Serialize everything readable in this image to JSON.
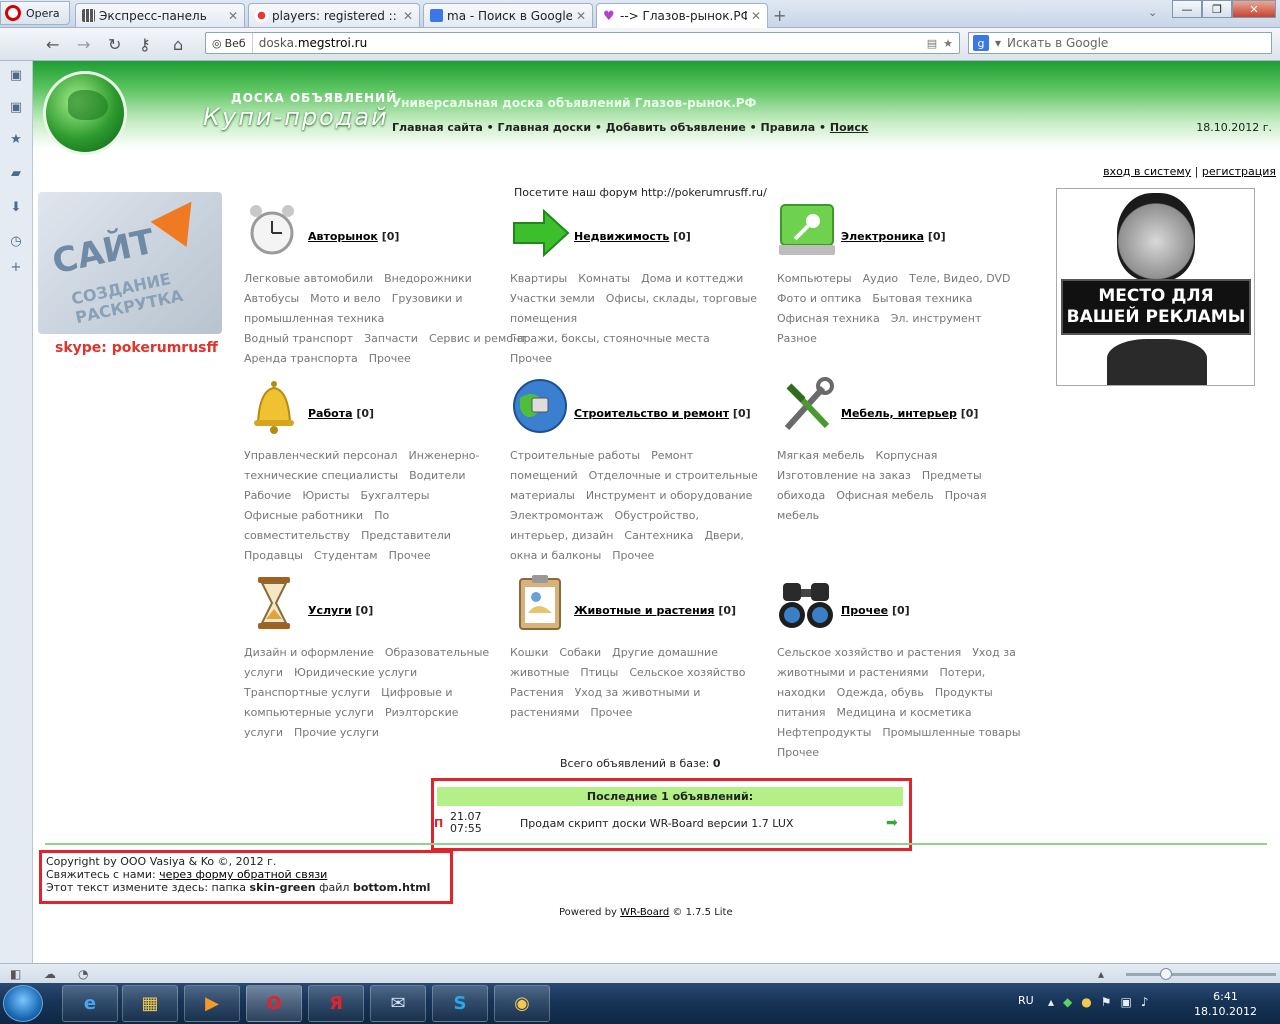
{
  "browser": {
    "menu_label": "Opera",
    "tabs": [
      {
        "title": "Экспресс-панель",
        "icon": "speed-dial-icon",
        "active": false
      },
      {
        "title": "players: registered :: Re...",
        "icon": "site-favicon",
        "active": false
      },
      {
        "title": "ma - Поиск в Google",
        "icon": "google-icon",
        "active": false
      },
      {
        "title": "--> Глазов-рынок.РФ",
        "icon": "heart-icon",
        "active": true
      }
    ],
    "address": {
      "badge": "Веб",
      "url_prefix": "doska.",
      "url_domain": "megstroi.ru"
    },
    "search_placeholder": "Искать в Google"
  },
  "header": {
    "logo_sub": "ДОСКА ОБЪЯВЛЕНИЙ",
    "logo_main": "Купи-продай",
    "site_title": "Универсальная доска объявлений Глазов-рынок.РФ",
    "nav": [
      "Главная сайта",
      "Главная доски",
      "Добавить объявление",
      "Правила",
      "Поиск"
    ],
    "nav_separator": " • ",
    "date": "18.10.2012 г."
  },
  "auth": {
    "login": "вход в систему",
    "register": "регистрация"
  },
  "forum_note": "Посетите наш форум http://pokerumrusff.ru/",
  "promo": {
    "text1": "САЙТ",
    "text2": "СОЗДАНИЕ РАСКРУТКА",
    "skype": "skype: pokerumrusff"
  },
  "ad": {
    "line1": "МЕСТО ДЛЯ",
    "line2": "ВАШЕЙ РЕКЛАМЫ"
  },
  "categories": [
    {
      "name": "Авторынок",
      "count": "[0]",
      "icon": "alarm-clock-icon",
      "subs": [
        "Легковые автомобили",
        "Внедорожники",
        "Автобусы",
        "Мото и вело",
        "Грузовики и промышленная техника",
        "Водный транспорт",
        "Запчасти",
        "Сервис и ремонт",
        "Аренда транспорта",
        "Прочее"
      ]
    },
    {
      "name": "Недвижимость",
      "count": "[0]",
      "icon": "green-arrow-icon",
      "subs": [
        "Квартиры",
        "Комнаты",
        "Дома и коттеджи",
        "Участки земли",
        "Офисы, склады, торговые помещения",
        "Гаражи, боксы, стояночные места",
        "Прочее"
      ]
    },
    {
      "name": "Электроника",
      "count": "[0]",
      "icon": "laptop-key-icon",
      "subs": [
        "Компьютеры",
        "Аудио",
        "Теле, Видео, DVD",
        "Фото и оптика",
        "Бытовая техника",
        "Офисная техника",
        "Эл. инструмент",
        "Разное"
      ]
    },
    {
      "name": "Работа",
      "count": "[0]",
      "icon": "bell-icon",
      "subs": [
        "Управленческий персонал",
        "Инженерно-технические специалисты",
        "Водители",
        "Рабочие",
        "Юристы",
        "Бухгалтеры",
        "Офисные работники",
        "По совместительству",
        "Представители",
        "Продавцы",
        "Студентам",
        "Прочее"
      ]
    },
    {
      "name": "Строительство и ремонт",
      "count": "[0]",
      "icon": "globe-network-icon",
      "subs": [
        "Строительные работы",
        "Ремонт помещений",
        "Отделочные и строительные материалы",
        "Инструмент и оборудование",
        "Электромонтаж",
        "Обустройство, интерьер, дизайн",
        "Сантехника",
        "Двери, окна и балконы",
        "Прочее"
      ]
    },
    {
      "name": "Мебель, интерьер",
      "count": "[0]",
      "icon": "tools-icon",
      "subs": [
        "Мягкая мебель",
        "Корпусная",
        "Изготовление на заказ",
        "Предметы обихода",
        "Офисная мебель",
        "Прочая мебель"
      ]
    },
    {
      "name": "Услуги",
      "count": "[0]",
      "icon": "hourglass-icon",
      "subs": [
        "Дизайн и оформление",
        "Образовательные услуги",
        "Юридические услуги",
        "Транспортные услуги",
        "Цифровые и компьютерные услуги",
        "Риэлторские услуги",
        "Прочие услуги"
      ]
    },
    {
      "name": "Животные и растения",
      "count": "[0]",
      "icon": "clipboard-icon",
      "subs": [
        "Кошки",
        "Собаки",
        "Другие домашние животные",
        "Птицы",
        "Сельское хозяйство",
        "Растения",
        "Уход за животными и растениями",
        "Прочее"
      ]
    },
    {
      "name": "Прочее",
      "count": "[0]",
      "icon": "binoculars-icon",
      "subs": [
        "Сельское хозяйство и растения",
        "Уход за животными и растениями",
        "Потери, находки",
        "Одежда, обувь",
        "Продукты питания",
        "Медицина и косметика",
        "Нефтепродукты",
        "Промышленные товары",
        "Прочее"
      ]
    }
  ],
  "total": {
    "label": "Всего объявлений в базе:",
    "value": "0"
  },
  "latest": {
    "header": "Последние 1 объявлений:",
    "marker": "П",
    "date": "21.07",
    "time": "07:55",
    "text": "Продам скрипт доски WR-Board версии 1.7 LUX"
  },
  "footer": {
    "copyright": "Copyright by ООО Vasiya & Ko ©, 2012 г.",
    "contact_prefix": "Свяжитесь с нами: ",
    "contact_link": "через форму обратной связи",
    "edit_prefix": "Этот текст измените здесь: папка ",
    "edit_folder": "skin-green",
    "edit_mid": " файл ",
    "edit_file": "bottom.html"
  },
  "powered": {
    "prefix": "Powered by ",
    "link": "WR-Board",
    "suffix": " © 1.7.5 Lite"
  },
  "taskbar": {
    "apps": [
      "ie-icon",
      "explorer-icon",
      "media-player-icon",
      "opera-icon",
      "yandex-icon",
      "mail-icon",
      "skype-icon",
      "chrome-icon"
    ],
    "lang": "RU",
    "time": "6:41",
    "date": "18.10.2012"
  },
  "colors": {
    "accent_green": "#1e9e33",
    "highlight_red": "#e3232b",
    "latest_header_bg": "#b3f088"
  }
}
